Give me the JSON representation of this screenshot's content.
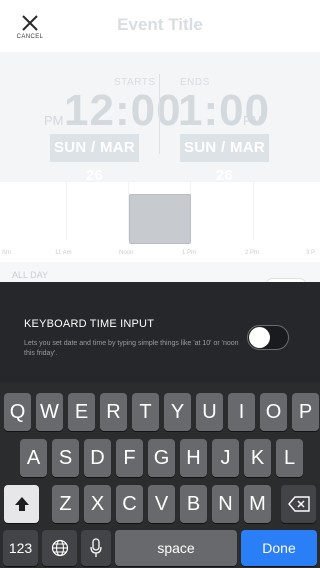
{
  "header": {
    "cancel_label": "CANCEL",
    "title": "Event Title",
    "cancel_icon": "close-icon"
  },
  "start": {
    "label": "STARTS",
    "ampm": "PM",
    "time": "12:00",
    "date": "SUN / MAR 26"
  },
  "end": {
    "label": "ENDS",
    "ampm": "PM",
    "time": "1:00",
    "date": "SUN / MAR 26"
  },
  "timeline": {
    "labels": [
      "Am",
      "11 Am",
      "Noon",
      "1 Pm",
      "2 Pm",
      "3 P"
    ]
  },
  "allday": {
    "label": "ALL DAY"
  },
  "popup": {
    "title": "KEYBOARD TIME INPUT",
    "description": "Lets you set date and time by typing simple things like 'at 10' or 'noon this friday'.",
    "switch_on": false
  },
  "keyboard": {
    "row1": [
      "Q",
      "W",
      "E",
      "R",
      "T",
      "Y",
      "U",
      "I",
      "O",
      "P"
    ],
    "row2": [
      "A",
      "S",
      "D",
      "F",
      "G",
      "H",
      "J",
      "K",
      "L"
    ],
    "row3": [
      "Z",
      "X",
      "C",
      "V",
      "B",
      "N",
      "M"
    ],
    "numbers_label": "123",
    "space_label": "space",
    "done_label": "Done",
    "icons": {
      "shift": "shift-icon",
      "backspace": "backspace-icon",
      "globe": "globe-icon",
      "mic": "microphone-icon"
    }
  },
  "colors": {
    "done_blue": "#2a7ef6",
    "keyboard_bg": "#2b2c2e",
    "popup_bg": "#26272b"
  }
}
